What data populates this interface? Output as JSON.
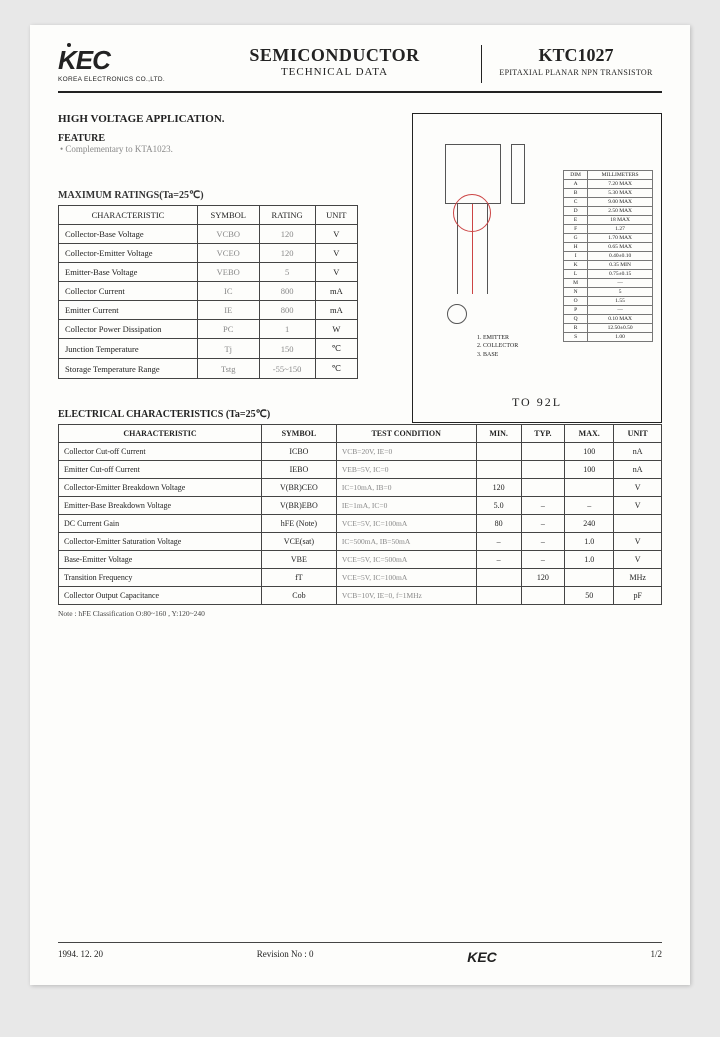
{
  "header": {
    "logo": "KEC",
    "logo_sub": "KOREA ELECTRONICS CO.,LTD.",
    "title_main": "SEMICONDUCTOR",
    "title_sub": "TECHNICAL DATA",
    "part_no": "KTC1027",
    "part_desc": "EPITAXIAL PLANAR NPN TRANSISTOR"
  },
  "app": {
    "title": "HIGH VOLTAGE APPLICATION.",
    "feature_label": "FEATURE",
    "feature_item": "• Complementary to KTA1023."
  },
  "ratings": {
    "title": "MAXIMUM RATINGS(Ta=25℃)",
    "headers": [
      "CHARACTERISTIC",
      "SYMBOL",
      "RATING",
      "UNIT"
    ],
    "rows": [
      {
        "char": "Collector-Base Voltage",
        "sym": "VCBO",
        "rat": "120",
        "unit": "V"
      },
      {
        "char": "Collector-Emitter Voltage",
        "sym": "VCEO",
        "rat": "120",
        "unit": "V"
      },
      {
        "char": "Emitter-Base Voltage",
        "sym": "VEBO",
        "rat": "5",
        "unit": "V"
      },
      {
        "char": "Collector Current",
        "sym": "IC",
        "rat": "800",
        "unit": "mA"
      },
      {
        "char": "Emitter Current",
        "sym": "IE",
        "rat": "800",
        "unit": "mA"
      },
      {
        "char": "Collector Power Dissipation",
        "sym": "PC",
        "rat": "1",
        "unit": "W"
      },
      {
        "char": "Junction Temperature",
        "sym": "Tj",
        "rat": "150",
        "unit": "℃"
      },
      {
        "char": "Storage Temperature Range",
        "sym": "Tstg",
        "rat": "-55~150",
        "unit": "℃"
      }
    ]
  },
  "package": {
    "label": "TO 92L",
    "dim_header": [
      "DIM",
      "MILLIMETERS"
    ],
    "dims": [
      [
        "A",
        "7.20 MAX"
      ],
      [
        "B",
        "5.30 MAX"
      ],
      [
        "C",
        "9.00 MAX"
      ],
      [
        "D",
        "2.50 MAX"
      ],
      [
        "E",
        "18 MAX"
      ],
      [
        "F",
        "1.27"
      ],
      [
        "G",
        "1.70 MAX"
      ],
      [
        "H",
        "0.65 MAX"
      ],
      [
        "I",
        "0.40±0.10"
      ],
      [
        "K",
        "0.35 MIN"
      ],
      [
        "L",
        "0.75±0.15"
      ],
      [
        "M",
        "—"
      ],
      [
        "N",
        "5"
      ],
      [
        "O",
        "1.55"
      ],
      [
        "P",
        "—"
      ],
      [
        "Q",
        "0.10 MAX"
      ],
      [
        "R",
        "12.50±0.50"
      ],
      [
        "S",
        "1.00"
      ]
    ],
    "pins": [
      "1. EMITTER",
      "2. COLLECTOR",
      "3. BASE"
    ]
  },
  "elec": {
    "title": "ELECTRICAL CHARACTERISTICS (Ta=25℃)",
    "headers": [
      "CHARACTERISTIC",
      "SYMBOL",
      "TEST CONDITION",
      "MIN.",
      "TYP.",
      "MAX.",
      "UNIT"
    ],
    "rows": [
      {
        "char": "Collector Cut-off Current",
        "sym": "ICBO",
        "cond": "VCB=20V, IE=0",
        "min": "",
        "typ": "",
        "max": "100",
        "unit": "nA"
      },
      {
        "char": "Emitter Cut-off Current",
        "sym": "IEBO",
        "cond": "VEB=5V, IC=0",
        "min": "",
        "typ": "",
        "max": "100",
        "unit": "nA"
      },
      {
        "char": "Collector-Emitter Breakdown Voltage",
        "sym": "V(BR)CEO",
        "cond": "IC=10mA, IB=0",
        "min": "120",
        "typ": "",
        "max": "",
        "unit": "V"
      },
      {
        "char": "Emitter-Base Breakdown Voltage",
        "sym": "V(BR)EBO",
        "cond": "IE=1mA, IC=0",
        "min": "5.0",
        "typ": "–",
        "max": "–",
        "unit": "V"
      },
      {
        "char": "DC Current Gain",
        "sym": "hFE (Note)",
        "cond": "VCE=5V, IC=100mA",
        "min": "80",
        "typ": "–",
        "max": "240",
        "unit": ""
      },
      {
        "char": "Collector-Emitter Saturation Voltage",
        "sym": "VCE(sat)",
        "cond": "IC=500mA, IB=50mA",
        "min": "–",
        "typ": "–",
        "max": "1.0",
        "unit": "V"
      },
      {
        "char": "Base-Emitter Voltage",
        "sym": "VBE",
        "cond": "VCE=5V, IC=500mA",
        "min": "–",
        "typ": "–",
        "max": "1.0",
        "unit": "V"
      },
      {
        "char": "Transition Frequency",
        "sym": "fT",
        "cond": "VCE=5V, IC=100mA",
        "min": "",
        "typ": "120",
        "max": "",
        "unit": "MHz"
      },
      {
        "char": "Collector Output Capacitance",
        "sym": "Cob",
        "cond": "VCB=10V, IE=0, f=1MHz",
        "min": "",
        "typ": "",
        "max": "50",
        "unit": "pF"
      }
    ],
    "note": "Note : hFE Classification   O:80~160  ,  Y:120~240"
  },
  "footer": {
    "date": "1994. 12. 20",
    "rev": "Revision No : 0",
    "logo": "KEC",
    "page": "1/2"
  }
}
